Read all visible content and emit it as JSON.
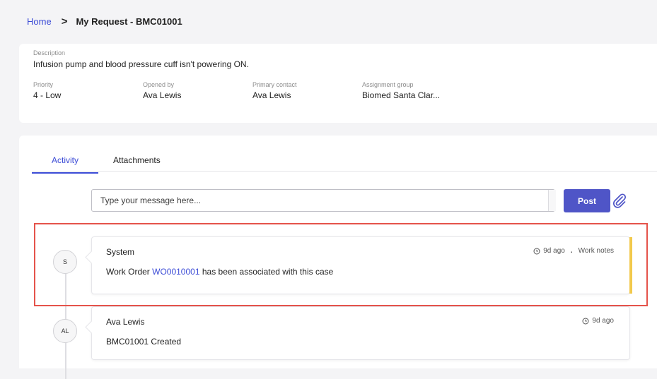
{
  "breadcrumb": {
    "home": "Home",
    "current": "My Request - BMC01001"
  },
  "details": {
    "description_label": "Description",
    "description": "Infusion pump and blood pressure cuff isn't powering ON.",
    "fields": [
      {
        "label": "Priority",
        "value": "4 - Low"
      },
      {
        "label": "Opened by",
        "value": "Ava Lewis"
      },
      {
        "label": "Primary contact",
        "value": "Ava Lewis"
      },
      {
        "label": "Assignment group",
        "value": "Biomed Santa Clar..."
      }
    ]
  },
  "tabs": [
    {
      "label": "Activity",
      "active": true
    },
    {
      "label": "Attachments",
      "active": false
    }
  ],
  "composer": {
    "placeholder": "Type your message here...",
    "post_label": "Post"
  },
  "activity": [
    {
      "initials": "S",
      "author": "System",
      "time": "9d ago",
      "type": "Work notes",
      "body_prefix": "Work Order ",
      "link": "WO0010001",
      "body_suffix": " has been associated with this case",
      "accent": "#f2c94c"
    },
    {
      "initials": "AL",
      "author": "Ava Lewis",
      "time": "9d ago",
      "body": "BMC01001 Created"
    }
  ],
  "colors": {
    "accent": "#3b4bd6",
    "post_button": "#4f55c7",
    "highlight": "#e5534b"
  }
}
